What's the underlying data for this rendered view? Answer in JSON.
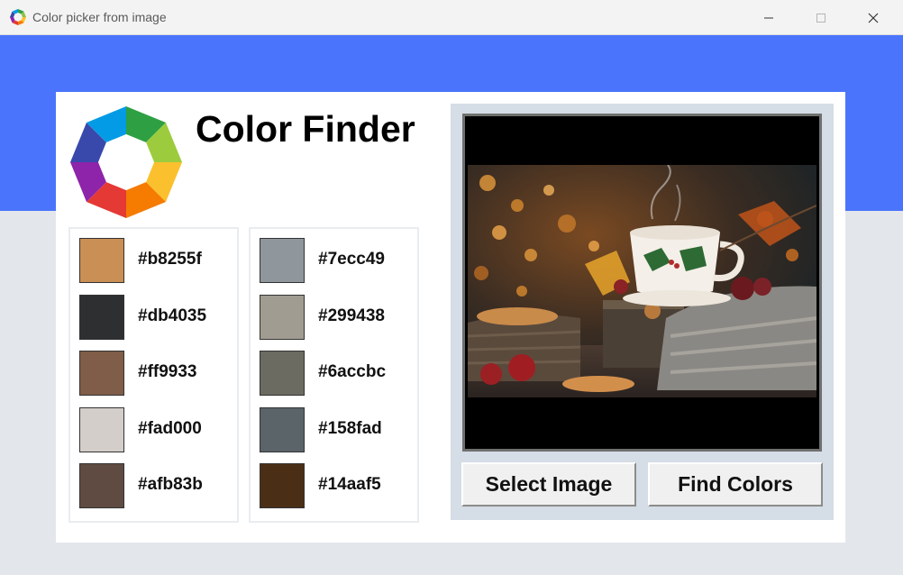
{
  "window": {
    "title": "Color picker from image",
    "app_icon": "color-wheel-icon",
    "controls": [
      "minimize-icon",
      "maximize-icon",
      "close-icon"
    ]
  },
  "theme": {
    "header_blue": "#4a74fb",
    "background_gray": "#e3e7ec",
    "panel_gray": "#d5dde6"
  },
  "header": {
    "title": "Color Finder",
    "logo": "color-wheel-logo"
  },
  "palette": {
    "column_1": [
      {
        "label": "#b8255f",
        "color": "#c98f54"
      },
      {
        "label": "#db4035",
        "color": "#2d2f31"
      },
      {
        "label": "#ff9933",
        "color": "#7f5d48"
      },
      {
        "label": "#fad000",
        "color": "#d4ceca"
      },
      {
        "label": "#afb83b",
        "color": "#5f4b41"
      }
    ],
    "column_2": [
      {
        "label": "#7ecc49",
        "color": "#8f969c"
      },
      {
        "label": "#299438",
        "color": "#a19c91"
      },
      {
        "label": "#6accbc",
        "color": "#6b6b62"
      },
      {
        "label": "#158fad",
        "color": "#5b6468"
      },
      {
        "label": "#14aaf5",
        "color": "#4a2f16"
      }
    ]
  },
  "image_panel": {
    "image": "festive-tea-cup-photo"
  },
  "buttons": {
    "select_image": "Select Image",
    "find_colors": "Find Colors"
  }
}
